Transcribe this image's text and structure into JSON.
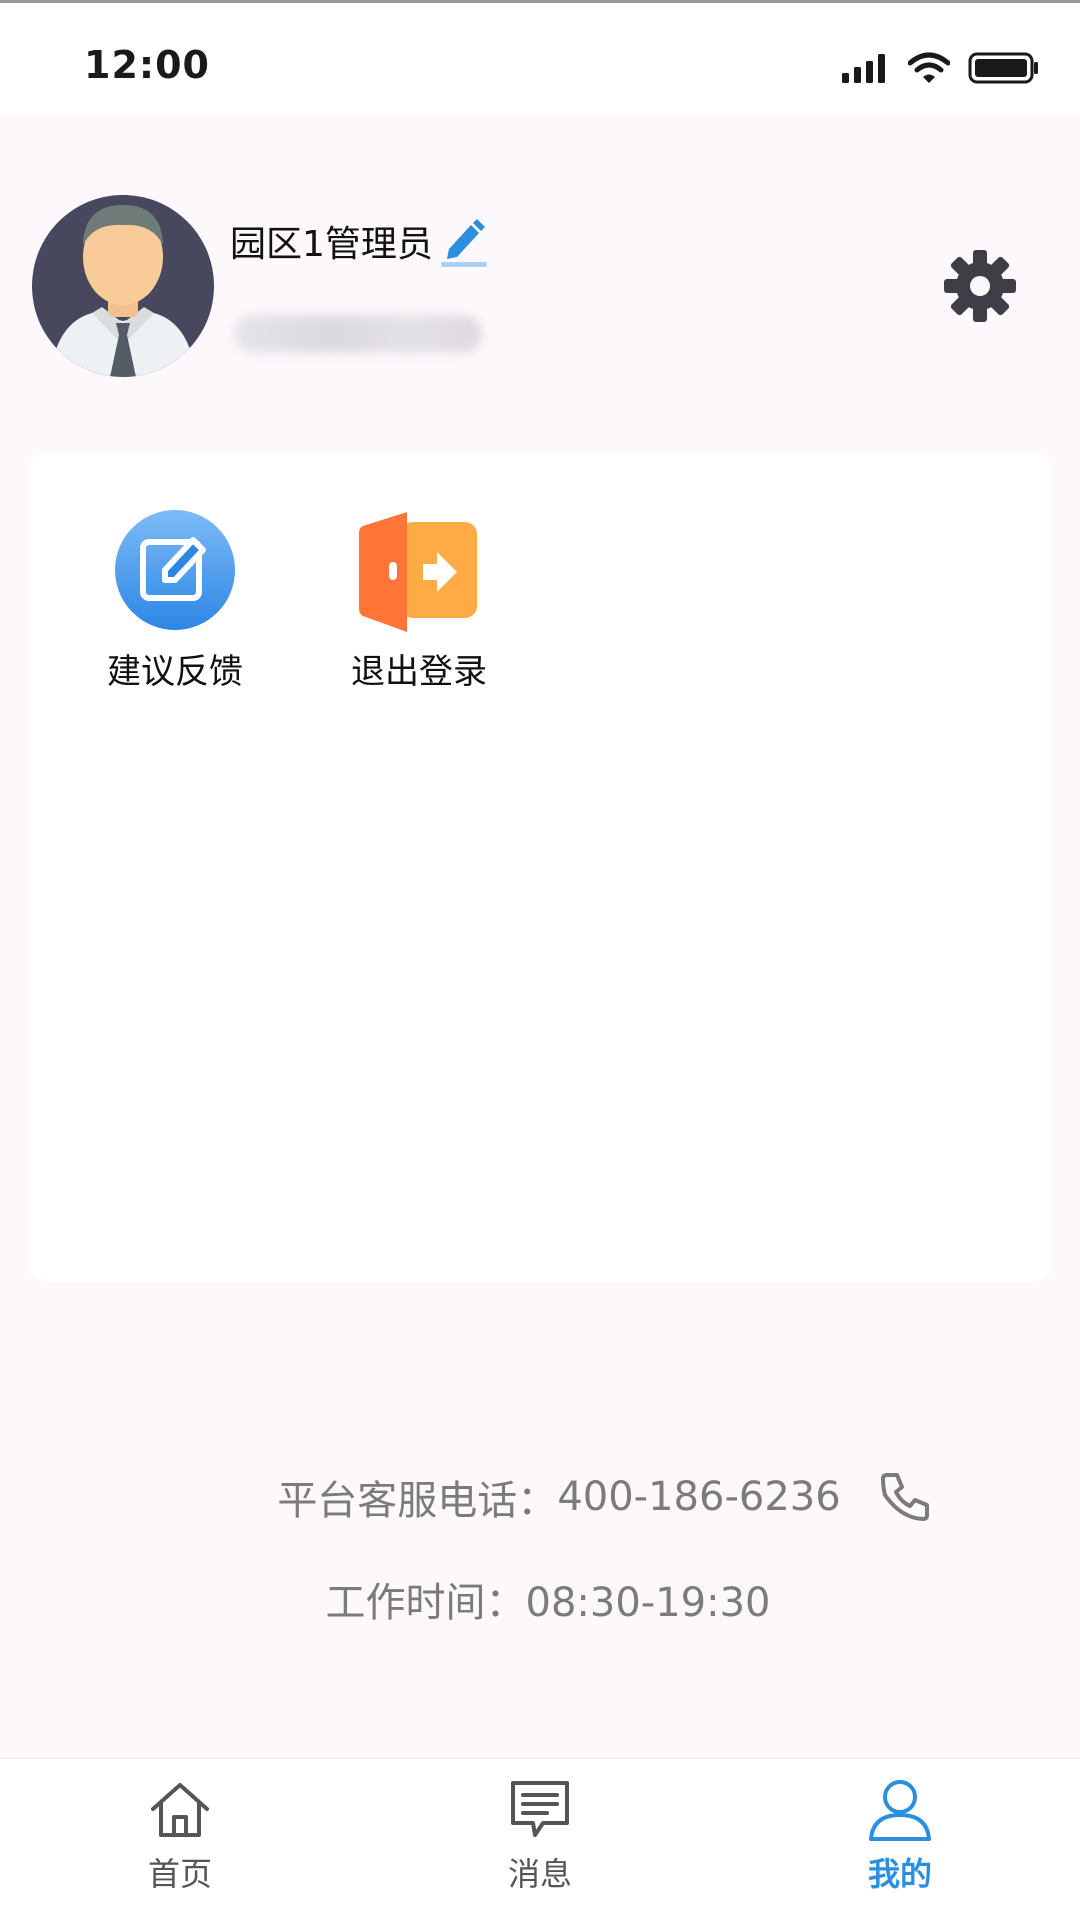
{
  "status_bar": {
    "time": "12:00",
    "icons": [
      "signal-icon",
      "wifi-icon",
      "battery-icon"
    ]
  },
  "profile": {
    "name": "园区1管理员",
    "phone_obscured": true,
    "avatar": "avatar-businessman",
    "settings_icon": "gear-icon"
  },
  "actions": [
    {
      "label": "建议反馈",
      "icon": "feedback-edit-icon",
      "color": "#3b95e8"
    },
    {
      "label": "退出登录",
      "icon": "logout-door-icon",
      "color": "#ff7b3a"
    }
  ],
  "service": {
    "phone_label": "平台客服电话：",
    "phone_number": "400-186-6236",
    "hours_label": "工作时间：",
    "hours_value": "08:30-19:30"
  },
  "tabbar": {
    "tabs": [
      {
        "label": "首页",
        "icon": "home-icon",
        "active": false
      },
      {
        "label": "消息",
        "icon": "message-icon",
        "active": false
      },
      {
        "label": "我的",
        "icon": "user-icon",
        "active": true
      }
    ],
    "active_color": "#2a8fe0"
  }
}
